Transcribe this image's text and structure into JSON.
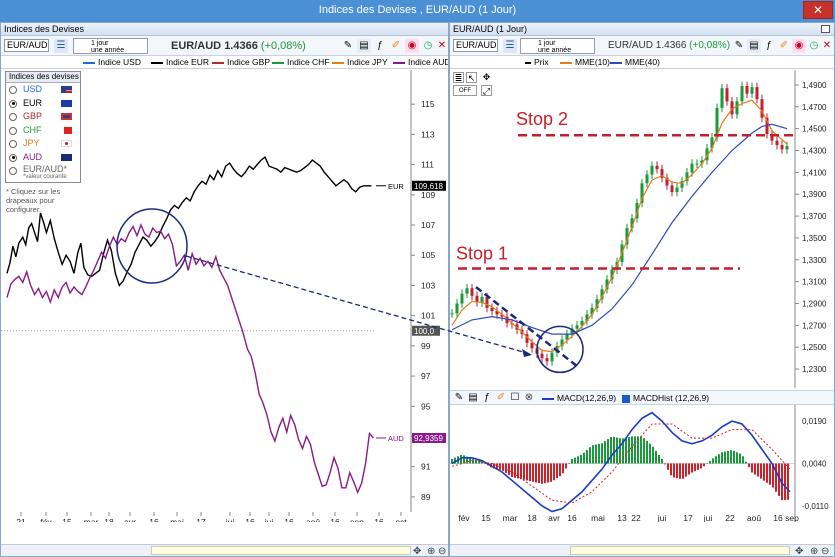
{
  "window": {
    "title": "Indices des Devises , EUR/AUD (1 Jour)",
    "close": "✕"
  },
  "left": {
    "panel_title": "Indices des Devises",
    "symbol": "EUR/AUD",
    "period_line1": "1 jour",
    "period_line2": "une année",
    "price_label": "EUR/AUD",
    "price": "1.4366",
    "change": "(+0,08%)",
    "legend": [
      {
        "name": "Indice USD",
        "color": "#2a6bd1"
      },
      {
        "name": "Indice EUR",
        "color": "#000000"
      },
      {
        "name": "Indice GBP",
        "color": "#b3262a"
      },
      {
        "name": "Indice CHF",
        "color": "#1a9a3a"
      },
      {
        "name": "Indice JPY",
        "color": "#e67c1a"
      },
      {
        "name": "Indice AUD",
        "color": "#8a1a8a"
      }
    ],
    "devises_title": "Indices des devises",
    "devises": [
      {
        "code": "USD",
        "color": "#2a6bd1",
        "on": false
      },
      {
        "code": "EUR",
        "color": "#000000",
        "on": true
      },
      {
        "code": "GBP",
        "color": "#b3262a",
        "on": false
      },
      {
        "code": "CHF",
        "color": "#1a9a3a",
        "on": false
      },
      {
        "code": "JPY",
        "color": "#e67c1a",
        "on": false
      },
      {
        "code": "AUD",
        "color": "#8a1a8a",
        "on": true
      }
    ],
    "pair_option": "EUR/AUD*",
    "pair_note": "*valeur courante",
    "hint": "* Cliquez sur les drapeaux pour configurer.",
    "y_ticks": [
      "115",
      "113",
      "111",
      "109",
      "107",
      "105",
      "103",
      "101",
      "99",
      "97",
      "95",
      "93",
      "91",
      "89"
    ],
    "x_ticks": [
      "21",
      "fév",
      "15",
      "mar",
      "18",
      "avr",
      "16",
      "mai",
      "17",
      "jui",
      "16",
      "jui",
      "16",
      "aoû",
      "16",
      "sep",
      "16",
      "oct"
    ],
    "eur_label": "EUR",
    "eur_value": "109,618",
    "aud_label": "AUD",
    "aud_value": "92,9359",
    "current_level": "100,0"
  },
  "right": {
    "panel_title": "EUR/AUD (1 Jour)",
    "symbol": "EUR/AUD",
    "period_line1": "1 jour",
    "period_line2": "une année",
    "price_label": "EUR/AUD",
    "price": "1.4366",
    "change": "(+0,08%)",
    "legend": [
      {
        "name": "Prix",
        "color": "#000000"
      },
      {
        "name": "MME(10)",
        "color": "#e67c1a"
      },
      {
        "name": "MME(40)",
        "color": "#2a4bbf"
      }
    ],
    "y_ticks": [
      "1,4900",
      "1,4700",
      "1,4500",
      "1,4300",
      "1,4100",
      "1,3900",
      "1,3700",
      "1,3500",
      "1,3300",
      "1,3100",
      "1,2900",
      "1,2700",
      "1,2500",
      "1,2300"
    ],
    "x_ticks": [
      "fév",
      "15",
      "mar",
      "18",
      "avr",
      "16",
      "mai",
      "13",
      "22",
      "jui",
      "17",
      "jui",
      "22",
      "aoû",
      "16",
      "sep"
    ],
    "stop1": "Stop 1",
    "stop2": "Stop 2",
    "macd_legend": [
      {
        "name": "MACD(12,26,9)",
        "color": "#1a3ac7"
      },
      {
        "name": "MACDHist (12,26,9)",
        "color": "#1a5ad1"
      }
    ],
    "macd_ticks": [
      "0,0190",
      "0,0040",
      "-0,0110"
    ]
  },
  "chart_data": [
    {
      "type": "line",
      "x_ticks_shown": [
        "21",
        "fév",
        "15",
        "mar",
        "18",
        "avr",
        "16",
        "mai",
        "17",
        "jui",
        "16",
        "jui",
        "16",
        "aoû",
        "16",
        "sep",
        "16",
        "oct"
      ],
      "ylim": [
        88,
        117
      ],
      "series": [
        {
          "name": "Indice EUR",
          "color": "#000000",
          "x": [
            0,
            3,
            6,
            9,
            12,
            16,
            19,
            22,
            25,
            28,
            31,
            34,
            37,
            40,
            44,
            48,
            52,
            56,
            60,
            64,
            68,
            70,
            72,
            75,
            78,
            82,
            86,
            90,
            94,
            98,
            102,
            106,
            110,
            114,
            118,
            122,
            126,
            130,
            134,
            138,
            142,
            146,
            150,
            154,
            158,
            162,
            166,
            170,
            174,
            178,
            182,
            186,
            190,
            194,
            198,
            202,
            206,
            210,
            214,
            218,
            222,
            226,
            230,
            234,
            238,
            242,
            246,
            250,
            254,
            258,
            262,
            266,
            270,
            274,
            278,
            282,
            286,
            290,
            294,
            298,
            302,
            306,
            310,
            314,
            318,
            322,
            326,
            330,
            334,
            338,
            342,
            346,
            350,
            354,
            358,
            362,
            366,
            370
          ],
          "values": [
            103.8,
            104.5,
            105.6,
            104.9,
            105.8,
            106.2,
            105.7,
            106.8,
            107.1,
            106.5,
            105.9,
            107.8,
            107.2,
            106.5,
            107.3,
            106.1,
            105.2,
            104.4,
            105.0,
            104.6,
            103.8,
            104.5,
            105.2,
            105.8,
            104.2,
            103.7,
            103.6,
            103.8,
            104.0,
            105.1,
            106.0,
            105.3,
            103.8,
            103.0,
            103.3,
            103.9,
            104.4,
            105.2,
            105.7,
            106.2,
            106.0,
            105.6,
            105.9,
            106.3,
            106.9,
            107.4,
            108.0,
            108.3,
            108.1,
            108.5,
            108.8,
            108.6,
            109.2,
            109.6,
            109.9,
            109.7,
            110.3,
            110.0,
            110.6,
            110.2,
            110.9,
            111.1,
            110.7,
            110.4,
            110.2,
            110.5,
            110.9,
            110.7,
            111.0,
            111.3,
            111.5,
            110.9,
            110.8,
            110.7,
            110.5,
            110.8,
            110.7,
            110.6,
            110.5,
            110.6,
            110.8,
            111.0,
            111.3,
            111.1,
            110.9,
            110.5,
            110.2,
            109.9,
            109.6,
            109.8,
            110.0,
            109.8,
            109.4,
            109.2,
            109.5,
            109.6,
            109.6,
            109.6
          ]
        },
        {
          "name": "Indice AUD",
          "color": "#8a1a8a",
          "x": [
            0,
            4,
            8,
            12,
            16,
            20,
            24,
            28,
            32,
            36,
            40,
            44,
            48,
            52,
            56,
            60,
            64,
            68,
            72,
            76,
            80,
            84,
            88,
            92,
            96,
            100,
            104,
            108,
            112,
            116,
            120,
            124,
            128,
            132,
            136,
            140,
            144,
            148,
            152,
            156,
            160,
            164,
            168,
            172,
            176,
            180,
            184,
            188,
            192,
            196,
            200,
            204,
            208,
            212,
            216,
            220,
            224,
            228,
            232,
            236,
            240,
            244,
            248,
            252,
            256,
            260,
            264,
            268,
            272,
            276,
            280,
            284,
            288,
            292,
            296,
            300,
            304,
            308,
            312,
            316,
            320,
            324,
            328,
            332,
            336,
            340,
            344,
            348,
            352,
            356,
            360,
            364,
            368,
            372
          ],
          "values": [
            102.2,
            103.1,
            103.4,
            103.6,
            103.2,
            103.9,
            103.0,
            102.4,
            102.8,
            102.2,
            102.6,
            101.9,
            102.7,
            102.2,
            102.9,
            103.2,
            102.5,
            102.9,
            102.6,
            102.4,
            102.9,
            103.5,
            104.0,
            104.6,
            105.2,
            104.8,
            105.6,
            106.2,
            105.7,
            106.1,
            105.9,
            106.5,
            106.9,
            106.3,
            107.0,
            106.4,
            106.2,
            106.8,
            106.5,
            106.6,
            106.1,
            106.4,
            105.7,
            104.3,
            104.6,
            105.0,
            104.0,
            105.1,
            104.4,
            104.8,
            104.3,
            104.6,
            104.2,
            104.9,
            104.0,
            103.5,
            103.0,
            102.2,
            101.4,
            100.6,
            99.8,
            98.8,
            98.3,
            97.2,
            95.8,
            95.2,
            94.4,
            93.3,
            92.7,
            93.6,
            94.2,
            93.3,
            94.4,
            93.8,
            92.8,
            92.2,
            93.0,
            92.5,
            91.3,
            90.5,
            89.7,
            89.8,
            90.6,
            91.6,
            90.9,
            89.6,
            89.6,
            90.6,
            90.0,
            89.3,
            89.9,
            91.2,
            93.2,
            92.9
          ]
        }
      ]
    },
    {
      "type": "line",
      "x_ticks_shown": [
        "fév",
        "15",
        "mar",
        "18",
        "avr",
        "16",
        "mai",
        "13",
        "22",
        "jui",
        "17",
        "jui",
        "22",
        "aoû",
        "16",
        "sep"
      ],
      "ylim": [
        1.22,
        1.5
      ],
      "stop_levels": [
        {
          "name": "Stop 1",
          "value": 1.322
        },
        {
          "name": "Stop 2",
          "value": 1.444
        }
      ],
      "series": [
        {
          "name": "Prix",
          "color": "#1a9a3a",
          "x": [
            0,
            5,
            10,
            15,
            20,
            25,
            30,
            35,
            40,
            45,
            50,
            55,
            60,
            65,
            70,
            75,
            80,
            85,
            90,
            95,
            100,
            105,
            110,
            115,
            120,
            125,
            130,
            135,
            140,
            145,
            150,
            155,
            160,
            165,
            170,
            175,
            180,
            185,
            190,
            195,
            200,
            205,
            210,
            215,
            220,
            225,
            230,
            235,
            240,
            245,
            250,
            255,
            260,
            265,
            270,
            275,
            280,
            285,
            290,
            295,
            300,
            305,
            310,
            315,
            320,
            325,
            330,
            335
          ],
          "values": [
            1.281,
            1.29,
            1.299,
            1.304,
            1.297,
            1.291,
            1.296,
            1.286,
            1.283,
            1.28,
            1.278,
            1.272,
            1.271,
            1.266,
            1.262,
            1.254,
            1.249,
            1.244,
            1.24,
            1.237,
            1.245,
            1.251,
            1.257,
            1.262,
            1.267,
            1.27,
            1.274,
            1.28,
            1.286,
            1.294,
            1.303,
            1.312,
            1.321,
            1.328,
            1.344,
            1.359,
            1.368,
            1.382,
            1.4,
            1.408,
            1.416,
            1.413,
            1.405,
            1.398,
            1.392,
            1.396,
            1.402,
            1.41,
            1.418,
            1.418,
            1.421,
            1.432,
            1.442,
            1.469,
            1.487,
            1.475,
            1.463,
            1.475,
            1.489,
            1.482,
            1.488,
            1.477,
            1.46,
            1.445,
            1.439,
            1.435,
            1.431,
            1.434
          ]
        },
        {
          "name": "MME(10)",
          "color": "#e67c1a",
          "x": [
            0,
            10,
            20,
            30,
            40,
            50,
            60,
            70,
            80,
            90,
            100,
            110,
            120,
            130,
            140,
            150,
            160,
            170,
            180,
            190,
            200,
            210,
            220,
            230,
            240,
            250,
            260,
            270,
            280,
            290,
            300,
            310,
            320,
            335
          ],
          "values": [
            1.27,
            1.284,
            1.292,
            1.291,
            1.287,
            1.28,
            1.272,
            1.264,
            1.255,
            1.247,
            1.246,
            1.252,
            1.26,
            1.269,
            1.28,
            1.296,
            1.314,
            1.336,
            1.36,
            1.386,
            1.403,
            1.407,
            1.401,
            1.4,
            1.408,
            1.418,
            1.432,
            1.455,
            1.468,
            1.473,
            1.476,
            1.466,
            1.448,
            1.436
          ]
        },
        {
          "name": "MME(40)",
          "color": "#2a4bbf",
          "x": [
            0,
            20,
            40,
            60,
            80,
            100,
            120,
            140,
            160,
            180,
            200,
            220,
            240,
            260,
            280,
            300,
            310,
            320,
            335
          ],
          "values": [
            1.266,
            1.275,
            1.278,
            1.275,
            1.268,
            1.262,
            1.262,
            1.27,
            1.285,
            1.307,
            1.335,
            1.364,
            1.388,
            1.41,
            1.43,
            1.446,
            1.452,
            1.454,
            1.45
          ]
        }
      ]
    },
    {
      "type": "line",
      "name": "MACD(12,26,9)",
      "ylim": [
        -0.016,
        0.024
      ],
      "series": [
        {
          "name": "MACD(12,26,9)",
          "color": "#1a3ac7",
          "x": [
            0,
            10,
            20,
            30,
            40,
            50,
            60,
            70,
            80,
            90,
            100,
            110,
            120,
            130,
            140,
            150,
            160,
            170,
            180,
            190,
            200,
            210,
            220,
            230,
            240,
            250,
            260,
            270,
            280,
            290,
            300,
            310,
            320,
            330,
            338
          ],
          "values": [
            0.004,
            0.006,
            0.006,
            0.005,
            0.003,
            0.001,
            -0.002,
            -0.005,
            -0.008,
            -0.011,
            -0.013,
            -0.012,
            -0.009,
            -0.006,
            -0.002,
            0.002,
            0.007,
            0.011,
            0.016,
            0.02,
            0.022,
            0.019,
            0.015,
            0.012,
            0.011,
            0.012,
            0.014,
            0.017,
            0.019,
            0.018,
            0.014,
            0.009,
            0.004,
            -0.003,
            -0.006
          ]
        },
        {
          "name": "Signal",
          "color": "#d0202a",
          "x": [
            0,
            20,
            40,
            60,
            80,
            100,
            120,
            140,
            160,
            180,
            200,
            220,
            240,
            260,
            280,
            300,
            320,
            338
          ],
          "values": [
            0.003,
            0.005,
            0.004,
            0.001,
            -0.004,
            -0.009,
            -0.01,
            -0.006,
            0.001,
            0.01,
            0.018,
            0.018,
            0.013,
            0.013,
            0.016,
            0.016,
            0.009,
            0.002
          ]
        }
      ]
    }
  ]
}
